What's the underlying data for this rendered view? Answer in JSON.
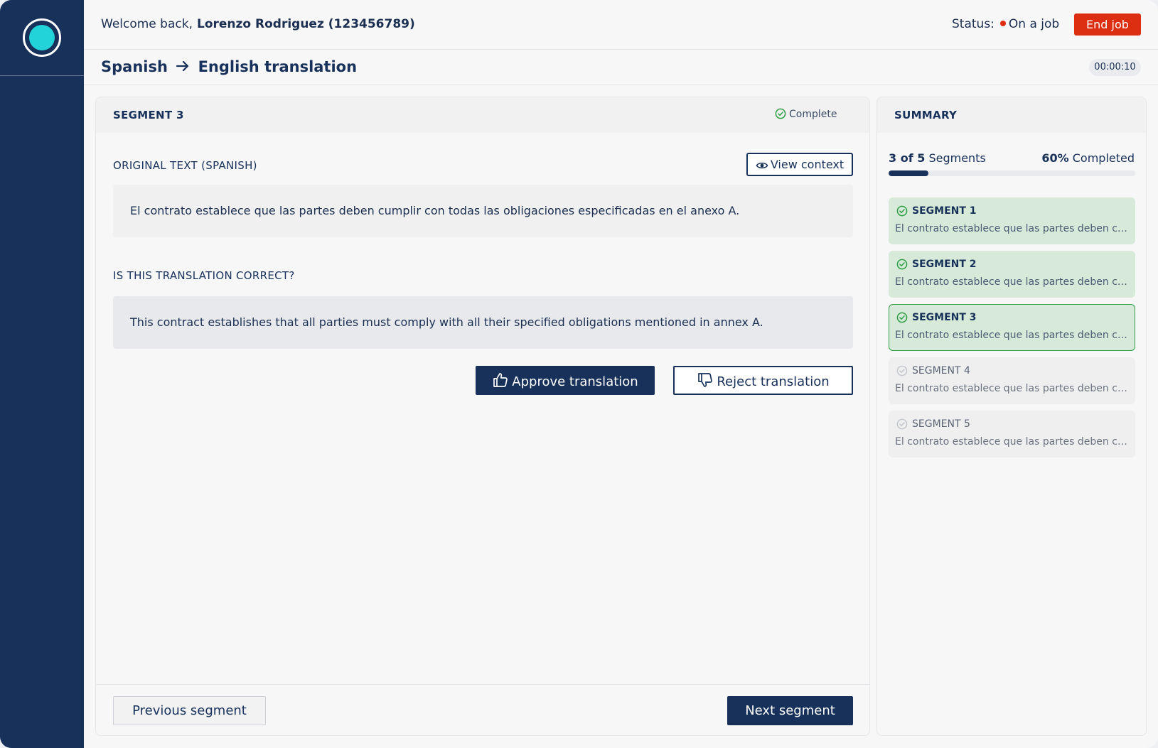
{
  "header": {
    "welcome_label": "Welcome back,",
    "user_name": "Lorenzo Rodriguez (123456789)",
    "status_label": "Status:",
    "status_value": "On a job",
    "status_color": "#e02d12",
    "end_job_label": "End job"
  },
  "job": {
    "source_language": "Spanish",
    "target_language": "English translation",
    "timer": "00:00:10"
  },
  "segment": {
    "title": "SEGMENT 3",
    "status": "Complete",
    "original_label": "ORIGINAL TEXT (SPANISH)",
    "view_context_label": "View context",
    "original_text": "El contrato establece que las partes deben cumplir con todas las obligaciones especificadas en el anexo A.",
    "question_label": "IS THIS TRANSLATION CORRECT?",
    "translation_text": "This contract establishes that all parties must comply with all their specified obligations mentioned in annex A.",
    "approve_label": "Approve translation",
    "reject_label": "Reject translation",
    "prev_label": "Previous segment",
    "next_label": "Next segment"
  },
  "summary": {
    "title": "SUMMARY",
    "segments_count": "3 of 5",
    "segments_word": "Segments",
    "percent": "60%",
    "completed_word": "Completed",
    "progress_fraction": 0.16,
    "items": [
      {
        "name": "SEGMENT 1",
        "snippet": "El contrato establece que las partes deben cumplir con todas las obligaciones especificadas en el anexo A.",
        "state": "done"
      },
      {
        "name": "SEGMENT 2",
        "snippet": "El contrato establece que las partes deben cumplir con todas las obligaciones especificadas en el anexo A.",
        "state": "done"
      },
      {
        "name": "SEGMENT 3",
        "snippet": "El contrato establece que las partes deben cumplir con todas las obligaciones especificadas en el anexo A.",
        "state": "active"
      },
      {
        "name": "SEGMENT 4",
        "snippet": "El contrato establece que las partes deben cumplir con todas las obligaciones especificadas en el anexo A.",
        "state": "pending"
      },
      {
        "name": "SEGMENT 5",
        "snippet": "El contrato establece que las partes deben cumplir con todas las obligaciones especificadas en el anexo A.",
        "state": "pending"
      }
    ]
  },
  "colors": {
    "navy": "#17315b",
    "accent_cyan": "#22d3d9",
    "danger": "#dc2e10",
    "success": "#2f9e46"
  },
  "icons": {
    "logo": "logo-icon",
    "check": "check-circle-icon",
    "eye": "eye-icon",
    "thumbs_up": "thumbs-up-icon",
    "thumbs_down": "thumbs-down-icon",
    "arrow": "arrow-right-icon"
  }
}
